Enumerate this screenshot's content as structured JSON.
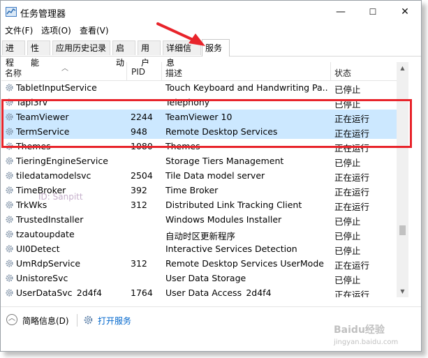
{
  "window": {
    "title": "任务管理器",
    "controls": {
      "minimize": "—",
      "maximize": "☐",
      "close": "✕"
    }
  },
  "menu": [
    "文件(F)",
    "选项(O)",
    "查看(V)"
  ],
  "tabs": [
    "进程",
    "性能",
    "应用历史记录",
    "启动",
    "用户",
    "详细信息",
    "服务"
  ],
  "active_tab": "服务",
  "columns": {
    "name": "名称",
    "pid": "PID",
    "desc": "描述",
    "status": "状态"
  },
  "services": [
    {
      "name": "TabletInputService",
      "pid": "",
      "desc": "Touch Keyboard and Handwriting Pa...",
      "status": "已停止",
      "selected": false
    },
    {
      "name": "Tapi3rv",
      "pid": "",
      "desc": "Telephony",
      "status": "已停止",
      "selected": false
    },
    {
      "name": "TeamViewer",
      "pid": "2244",
      "desc": "TeamViewer 10",
      "status": "正在运行",
      "selected": true
    },
    {
      "name": "TermService",
      "pid": "948",
      "desc": "Remote Desktop Services",
      "status": "正在运行",
      "selected": true
    },
    {
      "name": "Themes",
      "pid": "1080",
      "desc": "Themes",
      "status": "正在运行",
      "selected": false
    },
    {
      "name": "TieringEngineService",
      "pid": "",
      "desc": "Storage Tiers Management",
      "status": "已停止",
      "selected": false
    },
    {
      "name": "tiledatamodelsvc",
      "pid": "2504",
      "desc": "Tile Data model server",
      "status": "正在运行",
      "selected": false
    },
    {
      "name": "TimeBroker",
      "pid": "392",
      "desc": "Time Broker",
      "status": "正在运行",
      "selected": false
    },
    {
      "name": "TrkWks",
      "pid": "312",
      "desc": "Distributed Link Tracking Client",
      "status": "正在运行",
      "selected": false
    },
    {
      "name": "TrustedInstaller",
      "pid": "",
      "desc": "Windows Modules Installer",
      "status": "已停止",
      "selected": false
    },
    {
      "name": "tzautoupdate",
      "pid": "",
      "desc": "自动时区更新程序",
      "status": "已停止",
      "selected": false
    },
    {
      "name": "UI0Detect",
      "pid": "",
      "desc": "Interactive Services Detection",
      "status": "已停止",
      "selected": false
    },
    {
      "name": "UmRdpService",
      "pid": "312",
      "desc": "Remote Desktop Services UserMode ...",
      "status": "正在运行",
      "selected": false
    },
    {
      "name": "UnistoreSvc",
      "pid": "",
      "desc": "User Data Storage",
      "status": "已停止",
      "selected": false
    },
    {
      "name": "UserDataSvc_2d4f4",
      "pid": "1764",
      "desc": "User Data Access_2d4f4",
      "status": "正在运行",
      "selected": false
    }
  ],
  "scrollbar": {
    "up": "▲",
    "down": "▼",
    "position": 0.75
  },
  "footer": {
    "brief_info": "简略信息(D)",
    "open_services": "打开服务"
  },
  "watermarks": {
    "author": "ID: Sanpitt",
    "site": "Baidu经验",
    "site_url": "jingyan.baidu.com"
  },
  "colors": {
    "selection": "#cce8ff",
    "highlight_box": "#e8242b",
    "link": "#0066cc"
  }
}
